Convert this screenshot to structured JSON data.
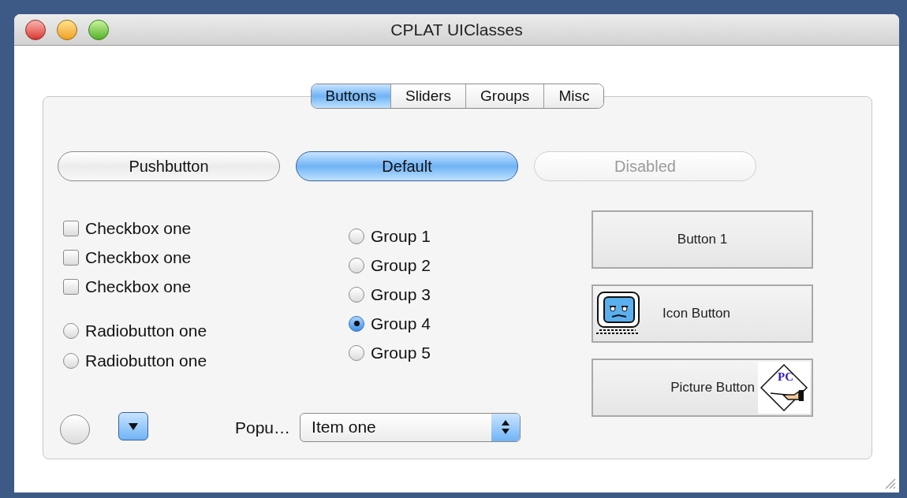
{
  "window": {
    "title": "CPLAT UIClasses"
  },
  "tabs": [
    {
      "label": "Buttons",
      "selected": true
    },
    {
      "label": "Sliders",
      "selected": false
    },
    {
      "label": "Groups",
      "selected": false
    },
    {
      "label": "Misc",
      "selected": false
    }
  ],
  "push_buttons": [
    {
      "label": "Pushbutton",
      "kind": "normal"
    },
    {
      "label": "Default",
      "kind": "default"
    },
    {
      "label": "Disabled",
      "kind": "disabled"
    }
  ],
  "checkboxes": [
    {
      "label": "Checkbox one",
      "checked": false
    },
    {
      "label": "Checkbox one",
      "checked": false
    },
    {
      "label": "Checkbox one",
      "checked": false
    }
  ],
  "radio_buttons": [
    {
      "label": "Radiobutton one",
      "selected": false
    },
    {
      "label": "Radiobutton one",
      "selected": false
    }
  ],
  "group_radios": [
    {
      "label": "Group 1",
      "selected": false
    },
    {
      "label": "Group 2",
      "selected": false
    },
    {
      "label": "Group 3",
      "selected": false
    },
    {
      "label": "Group 4",
      "selected": true
    },
    {
      "label": "Group 5",
      "selected": false
    }
  ],
  "bevel_buttons": [
    {
      "label": "Button 1",
      "kind": "plain"
    },
    {
      "label": "Icon Button",
      "kind": "icon"
    },
    {
      "label": "Picture Button",
      "kind": "picture",
      "picture_text": "PC"
    }
  ],
  "popup": {
    "label": "Popu…",
    "value": "Item one"
  }
}
